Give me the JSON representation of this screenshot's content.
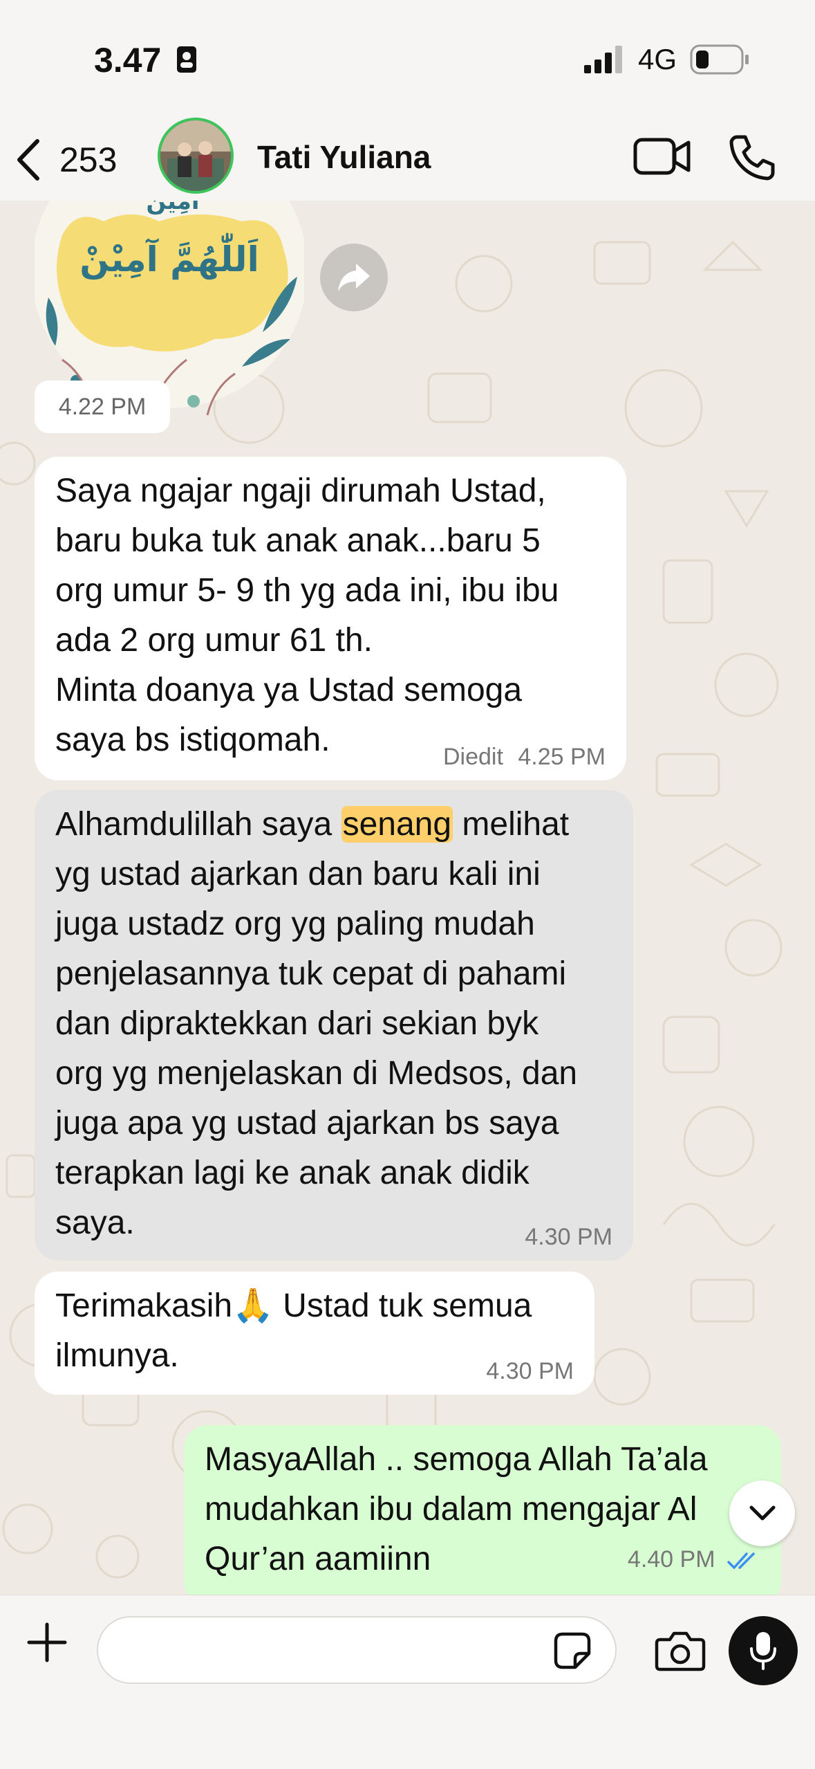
{
  "status": {
    "time": "3.47",
    "network": "4G"
  },
  "header": {
    "back_count": "253",
    "contact_name": "Tati Yuliana"
  },
  "sticker": {
    "arabic_top": "آمِيْن",
    "arabic_main": "اَللّٰهُمَّ آمِيْنْ"
  },
  "chat": {
    "sticker_time": "4.22 PM",
    "messages": [
      {
        "lines": [
          "Saya ngajar ngaji dirumah Ustad,",
          "baru buka tuk anak anak...baru 5",
          "org umur 5- 9 th yg ada ini, ibu ibu",
          "ada 2 org umur 61 th.",
          "Minta doanya ya Ustad  semoga",
          "saya bs istiqomah."
        ],
        "edited_label": "Diedit",
        "time": "4.25 PM"
      },
      {
        "line1_before": "Alhamdulillah saya ",
        "line1_highlight": "senang",
        "line1_after": " melihat",
        "lines": [
          "yg ustad ajarkan dan baru kali ini",
          "juga ustadz org yg paling mudah",
          "penjelasannya tuk cepat di pahami",
          "dan dipraktekkan dari sekian byk",
          "org yg menjelaskan di Medsos, dan",
          "juga apa yg ustad ajarkan bs saya",
          "terapkan lagi ke anak anak didik",
          "saya."
        ],
        "time": "4.30 PM"
      },
      {
        "lines": [
          "Terimakasih🙏 Ustad tuk semua",
          "ilmunya."
        ],
        "time": "4.30 PM"
      },
      {
        "lines": [
          "MasyaAllah .. semoga Allah Ta’ala",
          "mudahkan ibu dalam mengajar Al",
          "Qur’an aamiinn"
        ],
        "time": "4.40 PM"
      }
    ]
  },
  "input": {
    "placeholder": ""
  },
  "colors": {
    "outgoing_bubble": "#d9fdd3",
    "selected_bubble": "#e4e4e4",
    "highlight": "#ffcf6b",
    "read_ticks": "#3b8ff0",
    "avatar_ring": "#3dc45a"
  }
}
